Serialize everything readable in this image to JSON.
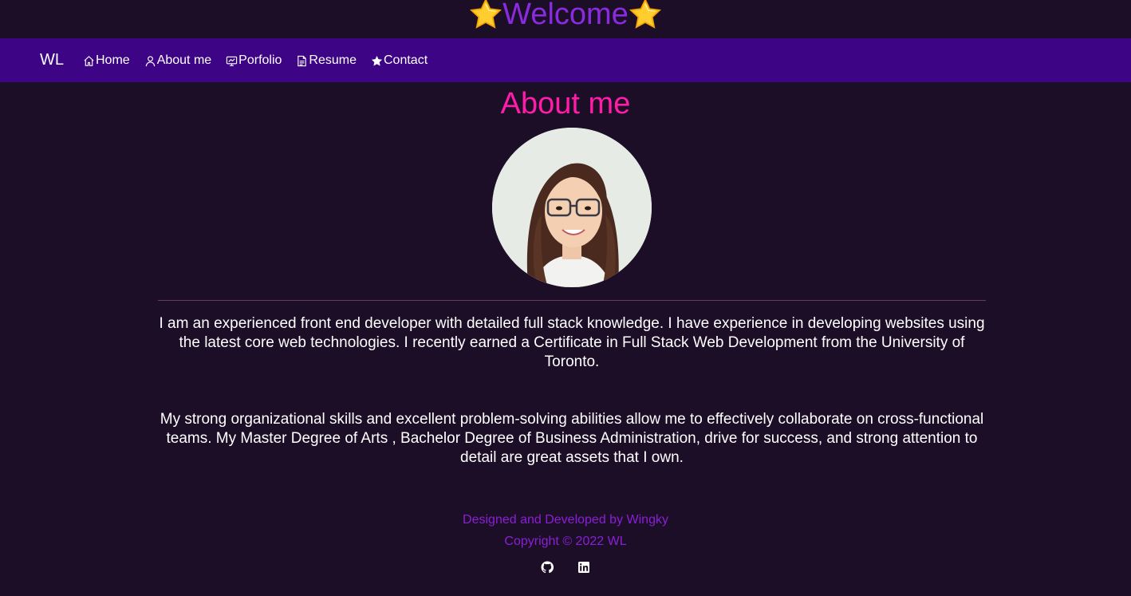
{
  "header": {
    "welcome_text": "Welcome",
    "star_icon": "star-emoji"
  },
  "navbar": {
    "brand": "WL",
    "items": [
      {
        "label": "Home",
        "icon": "home-icon"
      },
      {
        "label": "About me",
        "icon": "user-icon"
      },
      {
        "label": "Porfolio",
        "icon": "presentation-icon"
      },
      {
        "label": "Resume",
        "icon": "document-icon"
      },
      {
        "label": "Contact",
        "icon": "star-icon"
      }
    ]
  },
  "main": {
    "heading": "About me",
    "paragraphs": [
      "I am an experienced front end developer with detailed full stack knowledge. I have experience in developing websites using the latest core web technologies. I recently earned a Certificate in Full Stack Web Development from the University of Toronto.",
      "My strong organizational skills and excellent problem-solving abilities allow me to effectively collaborate on cross-functional teams. My Master Degree of Arts , Bachelor Degree of Business Administration, drive for success, and strong attention to detail are great assets that I own."
    ]
  },
  "footer": {
    "designed_by": "Designed and Developed by Wingky",
    "copyright": "Copyright © 2022 WL",
    "social": [
      "github-icon",
      "linkedin-icon"
    ]
  },
  "colors": {
    "background": "#1d0e28",
    "navbar": "#3d0586",
    "heading": "#ff1ca8",
    "welcome": "#8a2be2",
    "footer_text": "#8a1fd6"
  }
}
